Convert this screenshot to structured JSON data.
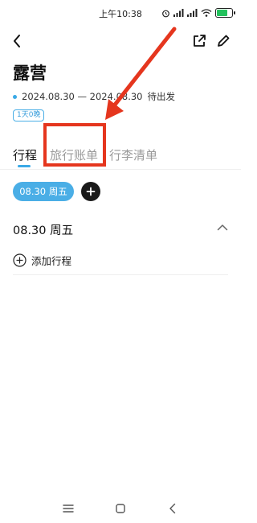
{
  "status_bar": {
    "time": "上午10:38",
    "icons": [
      "alarm-icon",
      "cell-signal-icon",
      "cell-signal-icon",
      "wifi-icon",
      "battery-icon"
    ],
    "battery_color": "#23c15d"
  },
  "header": {
    "back_icon": "chevron-left-icon",
    "share_icon": "share-icon",
    "edit_icon": "pencil-icon"
  },
  "trip": {
    "title": "露营",
    "dates": "2024.08.30 — 2024.08.30",
    "status": "待出发",
    "duration": "1天0晚"
  },
  "tabs": [
    {
      "label": "行程",
      "active": true
    },
    {
      "label": "旅行账单",
      "active": false,
      "highlighted": true
    },
    {
      "label": "行李清单",
      "active": false
    }
  ],
  "day_chips": [
    {
      "label": "08.30 周五",
      "selected": true
    }
  ],
  "days": [
    {
      "header": "08.30 周五",
      "add_label": "添加行程",
      "expanded": true
    }
  ],
  "colors": {
    "accent": "#4aaee6",
    "annotation_red": "#e5361e"
  },
  "system_nav": [
    "menu-icon",
    "home-icon",
    "back-icon"
  ]
}
